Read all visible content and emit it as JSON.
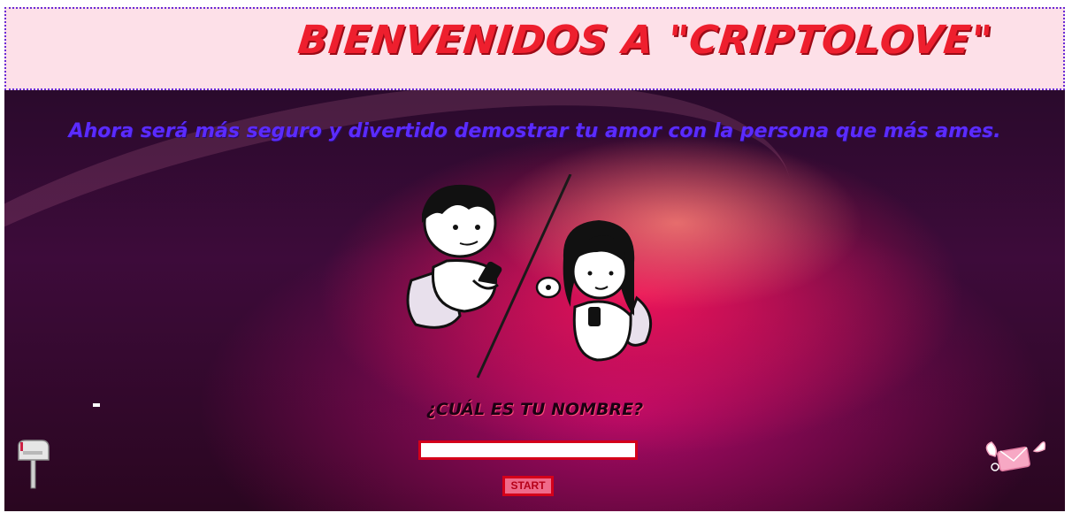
{
  "header": {
    "title": "Bienvenidos a \"CriptoLove\""
  },
  "main": {
    "subtitle": "Ahora será más seguro y divertido demostrar tu amor con la persona que más ames.",
    "question": "¿Cuál es tu nombre?",
    "name_input": {
      "value": "",
      "placeholder": ""
    },
    "start_label": "START"
  },
  "icons": [
    "couple-texting-illustration",
    "mailbox-icon",
    "winged-envelope-icon"
  ],
  "colors": {
    "header_bg": "#fde0e8",
    "title": "#ee1f2e",
    "subtitle": "#5b2bff",
    "border_red": "#d4001a",
    "start_bg": "#f06a8a"
  }
}
